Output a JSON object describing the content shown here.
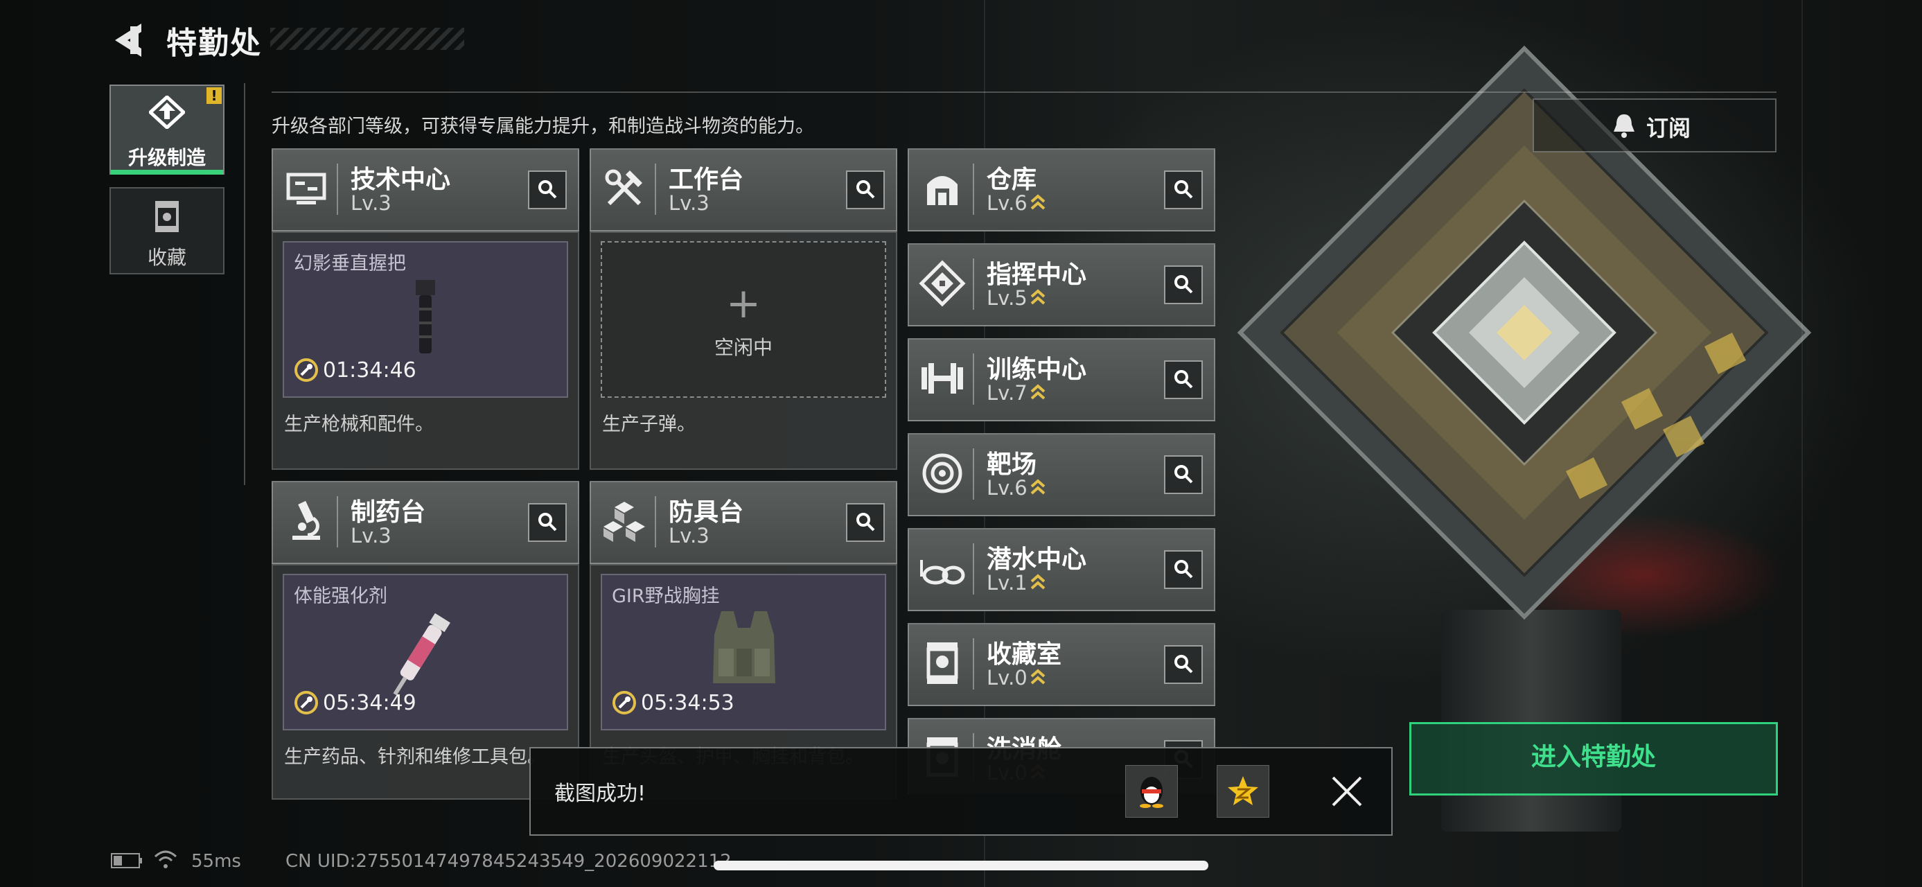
{
  "header": {
    "title": "特勤处"
  },
  "tabs": [
    {
      "label": "升级制造",
      "active": true,
      "badge": "!"
    },
    {
      "label": "收藏",
      "active": false
    }
  ],
  "description": "升级各部门等级，可获得专属能力提升，和制造战斗物资的能力。",
  "subscribe_label": "订阅",
  "workstations": [
    {
      "name": "技术中心",
      "level": "Lv.3",
      "icon": "computer-icon",
      "slot": {
        "item": "幻影垂直握把",
        "timer": "01:34:46"
      },
      "desc": "生产枪械和配件。"
    },
    {
      "name": "工作台",
      "level": "Lv.3",
      "icon": "tools-icon",
      "slot": {
        "empty": true,
        "plus": "+",
        "idle_label": "空闲中"
      },
      "desc": "生产子弹。"
    },
    {
      "name": "制药台",
      "level": "Lv.3",
      "icon": "microscope-icon",
      "slot": {
        "item": "体能强化剂",
        "timer": "05:34:49"
      },
      "desc": "生产药品、针剂和维修工具包。"
    },
    {
      "name": "防具台",
      "level": "Lv.3",
      "icon": "cubes-icon",
      "slot": {
        "item": "GIR野战胸挂",
        "timer": "05:34:53"
      },
      "desc": "生产头盔、护甲、胸挂和背包。"
    }
  ],
  "departments": [
    {
      "name": "仓库",
      "level": "Lv.6",
      "icon": "warehouse-icon"
    },
    {
      "name": "指挥中心",
      "level": "Lv.5",
      "icon": "command-icon"
    },
    {
      "name": "训练中心",
      "level": "Lv.7",
      "icon": "dumbbell-icon"
    },
    {
      "name": "靶场",
      "level": "Lv.6",
      "icon": "target-icon"
    },
    {
      "name": "潜水中心",
      "level": "Lv.1",
      "icon": "goggles-icon"
    },
    {
      "name": "收藏室",
      "level": "Lv.0",
      "icon": "trophy-case-icon"
    },
    {
      "name": "洗消舱",
      "level": "Lv.0",
      "icon": "decon-icon"
    }
  ],
  "enter_button": "进入特勤处",
  "toast": {
    "message": "截图成功!"
  },
  "status_bar": {
    "ping": "55ms",
    "uid": "CN UID:27550147497845243549_202609022112"
  },
  "colors": {
    "accent_green": "#2fd17c",
    "badge_yellow": "#e0b52a",
    "upgrade_gold": "#e3c04a"
  }
}
